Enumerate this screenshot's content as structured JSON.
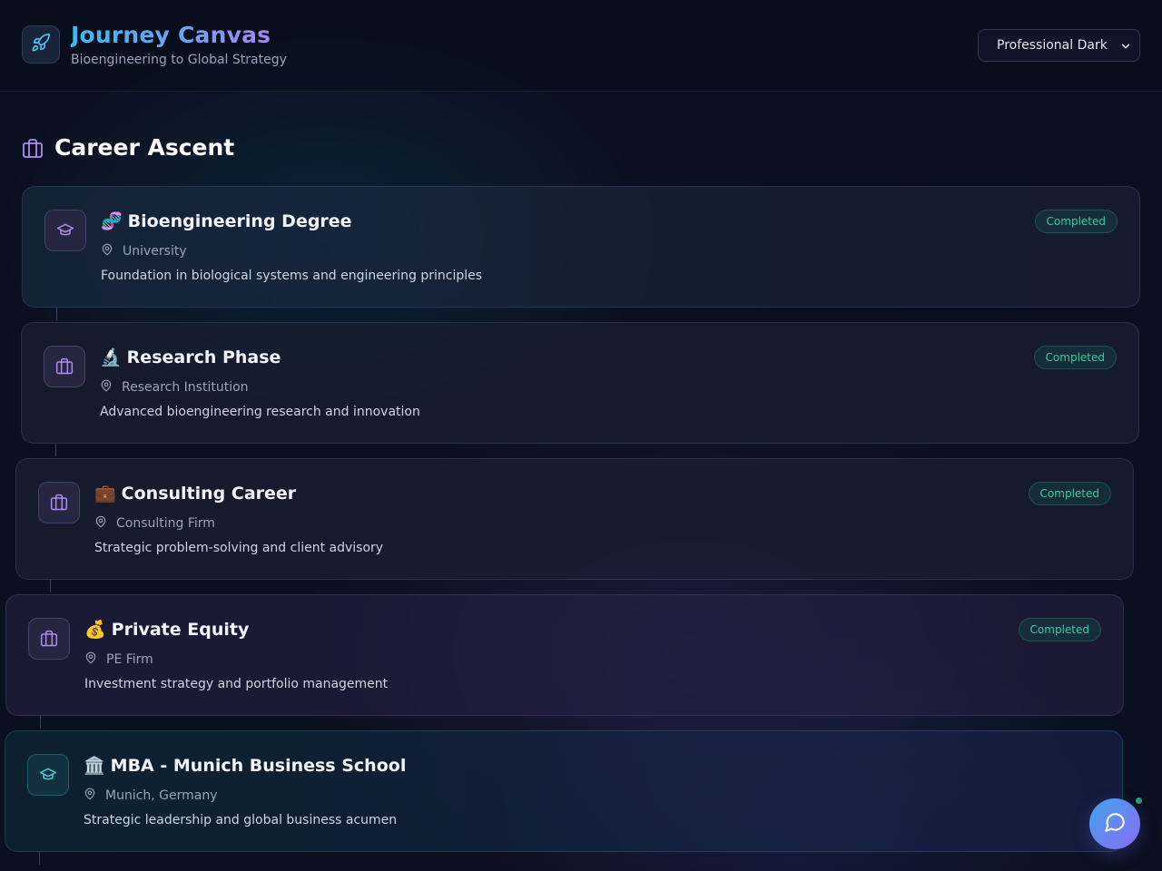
{
  "header": {
    "title": "Journey Canvas",
    "subtitle": "Bioengineering to Global Strategy",
    "logo_icon": "rocket-icon",
    "theme_select": {
      "value": "Professional Dark"
    }
  },
  "section": {
    "title": "Career Ascent",
    "icon": "briefcase-icon"
  },
  "milestones": [
    {
      "emoji": "🧬",
      "title": "Bioengineering Degree",
      "location": "University",
      "description": "Foundation in biological systems and engineering principles",
      "status": "Completed",
      "icon": "graduation-cap-icon"
    },
    {
      "emoji": "🔬",
      "title": "Research Phase",
      "location": "Research Institution",
      "description": "Advanced bioengineering research and innovation",
      "status": "Completed",
      "icon": "briefcase-icon"
    },
    {
      "emoji": "💼",
      "title": "Consulting Career",
      "location": "Consulting Firm",
      "description": "Strategic problem-solving and client advisory",
      "status": "Completed",
      "icon": "briefcase-icon"
    },
    {
      "emoji": "💰",
      "title": "Private Equity",
      "location": "PE Firm",
      "description": "Investment strategy and portfolio management",
      "status": "Completed",
      "icon": "briefcase-icon"
    },
    {
      "emoji": "🏛️",
      "title": "MBA - Munich Business School",
      "location": "Munich, Germany",
      "description": "Strategic leadership and global business acumen",
      "status": "",
      "icon": "graduation-cap-icon"
    }
  ],
  "colors": {
    "accent_teal": "#3fb8f0",
    "accent_purple": "#a885f0",
    "status_completed": "#3ec9a0"
  },
  "chat": {
    "icon": "chat-bubble-icon"
  }
}
